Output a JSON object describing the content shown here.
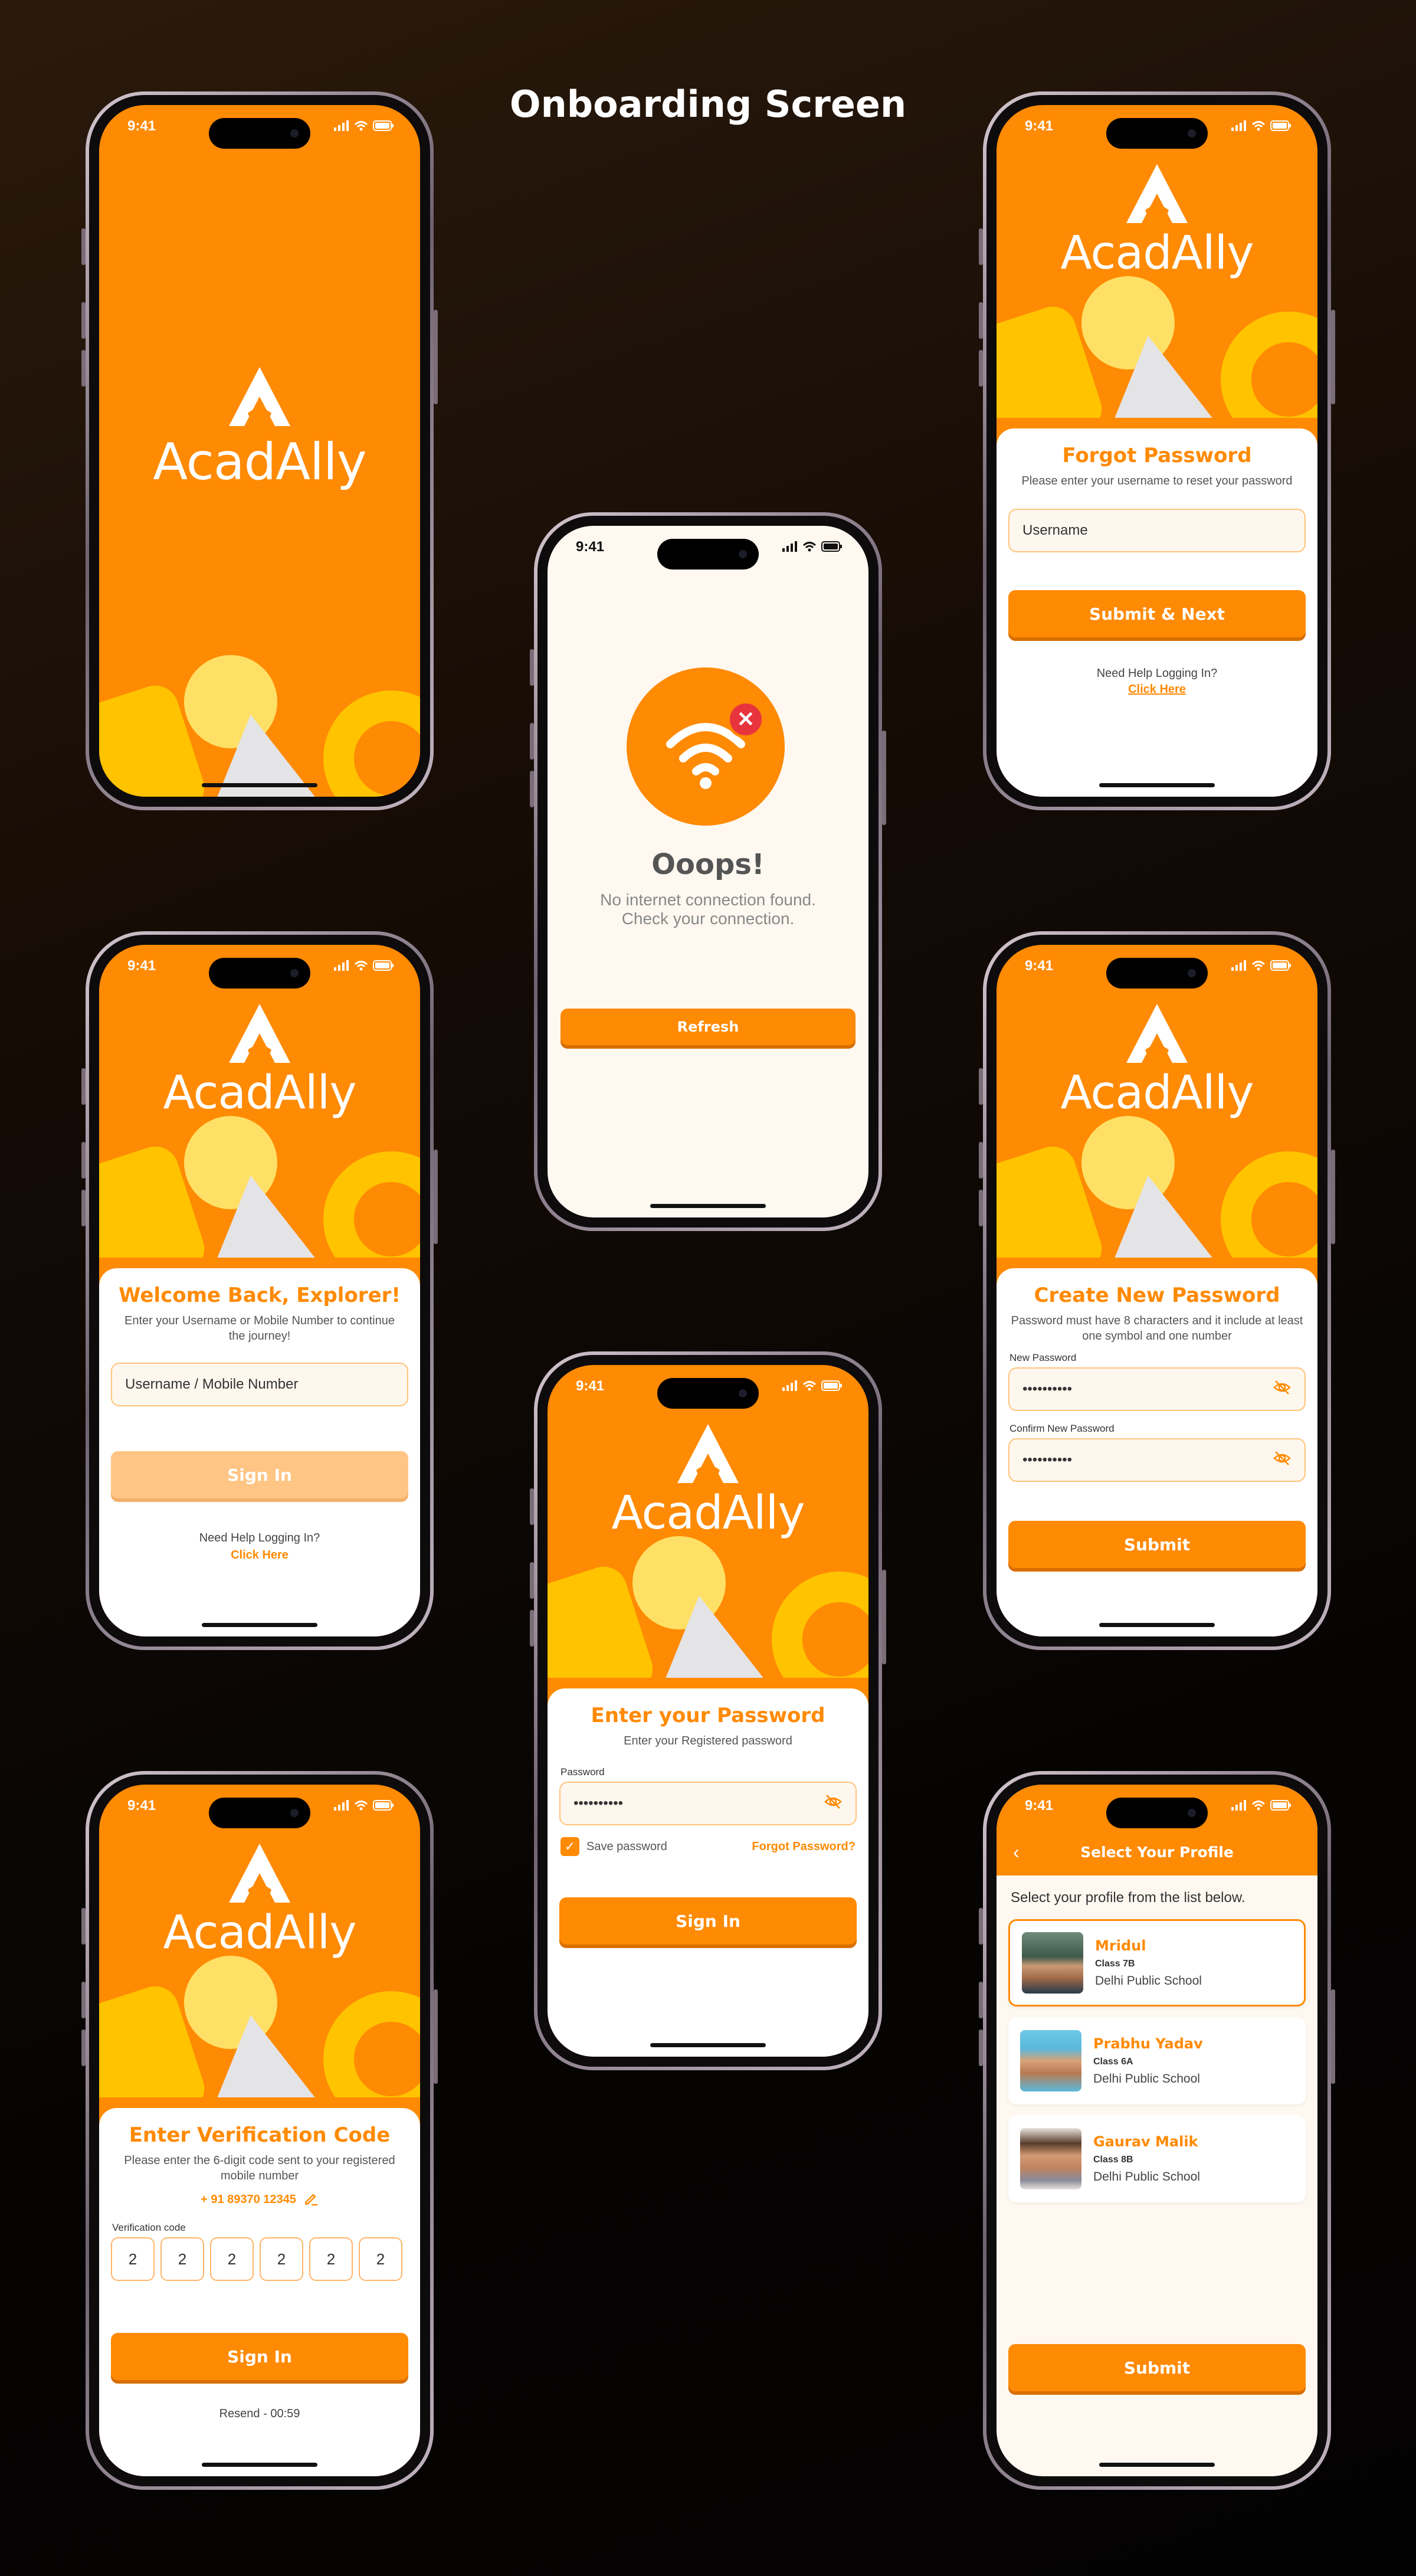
{
  "board": {
    "title": "Onboarding Screen"
  },
  "brand": {
    "name": "AcadAlly"
  },
  "status": {
    "time": "9:41"
  },
  "colors": {
    "accent": "#ff8a03",
    "accent_light": "#ffc584",
    "yellow": "#ffc300",
    "cream": "#fef8f0",
    "error": "#e8353d"
  },
  "no_internet": {
    "title": "Ooops!",
    "message": "No internet connection found. Check your connection.",
    "refresh_label": "Refresh"
  },
  "forgot_password": {
    "title": "Forgot Password",
    "subtitle": "Please enter your username to reset your password",
    "username_placeholder": "Username",
    "submit_label": "Submit & Next",
    "help_text": "Need Help Logging In?",
    "help_link": "Click Here"
  },
  "welcome": {
    "title": "Welcome Back, Explorer!",
    "subtitle": "Enter your Username or Mobile Number to continue the journey!",
    "input_placeholder": "Username / Mobile Number",
    "signin_label": "Sign In",
    "help_text": "Need Help Logging In?",
    "help_link": "Click Here"
  },
  "new_password": {
    "title": "Create New Password",
    "subtitle": "Password must have 8 characters and it include at least one symbol and one number",
    "new_label": "New Password",
    "new_value": "••••••••••",
    "confirm_label": "Confirm New Password",
    "confirm_value": "••••••••••",
    "submit_label": "Submit"
  },
  "enter_password": {
    "title": "Enter your Password",
    "subtitle": "Enter your Registered password",
    "password_label": "Password",
    "password_value": "••••••••••",
    "save_label": "Save password",
    "save_checked": true,
    "forgot_link": "Forgot Password?",
    "signin_label": "Sign In"
  },
  "verification": {
    "title": "Enter Verification Code",
    "subtitle": "Please enter the 6-digit code sent to your registered mobile number",
    "phone": "+ 91 89370 12345",
    "code_label": "Verification code",
    "digits": [
      "2",
      "2",
      "2",
      "2",
      "2",
      "2"
    ],
    "signin_label": "Sign In",
    "resend": "Resend - 00:59"
  },
  "select_profile": {
    "header": "Select Your Profile",
    "instruction": "Select your profile from the list below.",
    "profiles": [
      {
        "name": "Mridul",
        "class": "Class 7B",
        "school": "Delhi Public School",
        "selected": true
      },
      {
        "name": "Prabhu Yadav",
        "class": "Class 6A",
        "school": "Delhi Public School",
        "selected": false
      },
      {
        "name": "Gaurav Malik",
        "class": "Class 8B",
        "school": "Delhi Public School",
        "selected": false
      }
    ],
    "submit_label": "Submit"
  },
  "icons": [
    "signal-icon",
    "wifi-icon",
    "battery-icon",
    "wifi-off-icon",
    "error-x-icon",
    "eye-off-icon",
    "checkbox-icon",
    "edit-icon",
    "back-chevron-icon",
    "brand-logo-icon"
  ]
}
